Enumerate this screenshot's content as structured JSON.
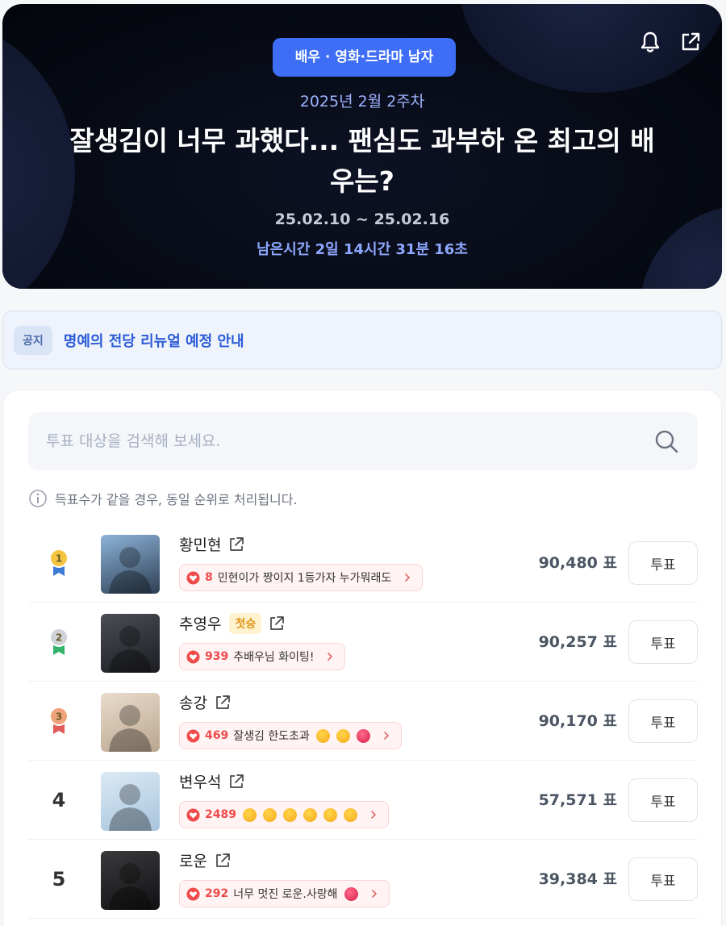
{
  "hero": {
    "category": "배우 · 영화·드라마 남자",
    "week": "2025년 2월 2주차",
    "title": "잘생김이 너무 과했다... 팬심도 과부하 온 최고의 배우는?",
    "date_range": "25.02.10 ~ 25.02.16",
    "remaining": "남은시간 2일 14시간 31분 16초",
    "icons": [
      "bell-icon",
      "share-icon"
    ]
  },
  "notice": {
    "tag": "공지",
    "text": "명예의 전당 리뉴얼 예정 안내"
  },
  "search": {
    "placeholder": "투표 대상을 검색해 보세요."
  },
  "info": "득표수가 같을 경우, 동일 순위로 처리됩니다.",
  "vote_label": "투표",
  "ranking": [
    {
      "rank": "1",
      "medal": "gold",
      "name": "황민현",
      "badge": "",
      "cheer_count": "8",
      "cheer_msg": "민현이가 짱이지 1등가자 누가뭐래도",
      "emojis": [],
      "votes": "90,480 표",
      "photo_bg": [
        "#8db3d8",
        "#2e3f54"
      ]
    },
    {
      "rank": "2",
      "medal": "silver",
      "name": "추영우",
      "badge": "첫승",
      "cheer_count": "939",
      "cheer_msg": "추배우님 화이팅!",
      "emojis": [],
      "votes": "90,257 표",
      "photo_bg": [
        "#4a4d55",
        "#1c1d22"
      ]
    },
    {
      "rank": "3",
      "medal": "bronze",
      "name": "송강",
      "badge": "",
      "cheer_count": "469",
      "cheer_msg": "잘생김 한도초과",
      "emojis": [
        "yellow",
        "yellow",
        "red"
      ],
      "votes": "90,170 표",
      "photo_bg": [
        "#e9dccb",
        "#b9a58f"
      ]
    },
    {
      "rank": "4",
      "medal": "",
      "name": "변우석",
      "badge": "",
      "cheer_count": "2489",
      "cheer_msg": "",
      "emojis": [
        "yellow",
        "yellow",
        "yellow",
        "yellow",
        "yellow",
        "yellow"
      ],
      "votes": "57,571 표",
      "photo_bg": [
        "#dbeaf5",
        "#a7c3dc"
      ]
    },
    {
      "rank": "5",
      "medal": "",
      "name": "로운",
      "badge": "",
      "cheer_count": "292",
      "cheer_msg": "너무 멋진 로운.사랑해",
      "emojis": [
        "red"
      ],
      "votes": "39,384 표",
      "photo_bg": [
        "#3a3a3d",
        "#111113"
      ]
    }
  ]
}
